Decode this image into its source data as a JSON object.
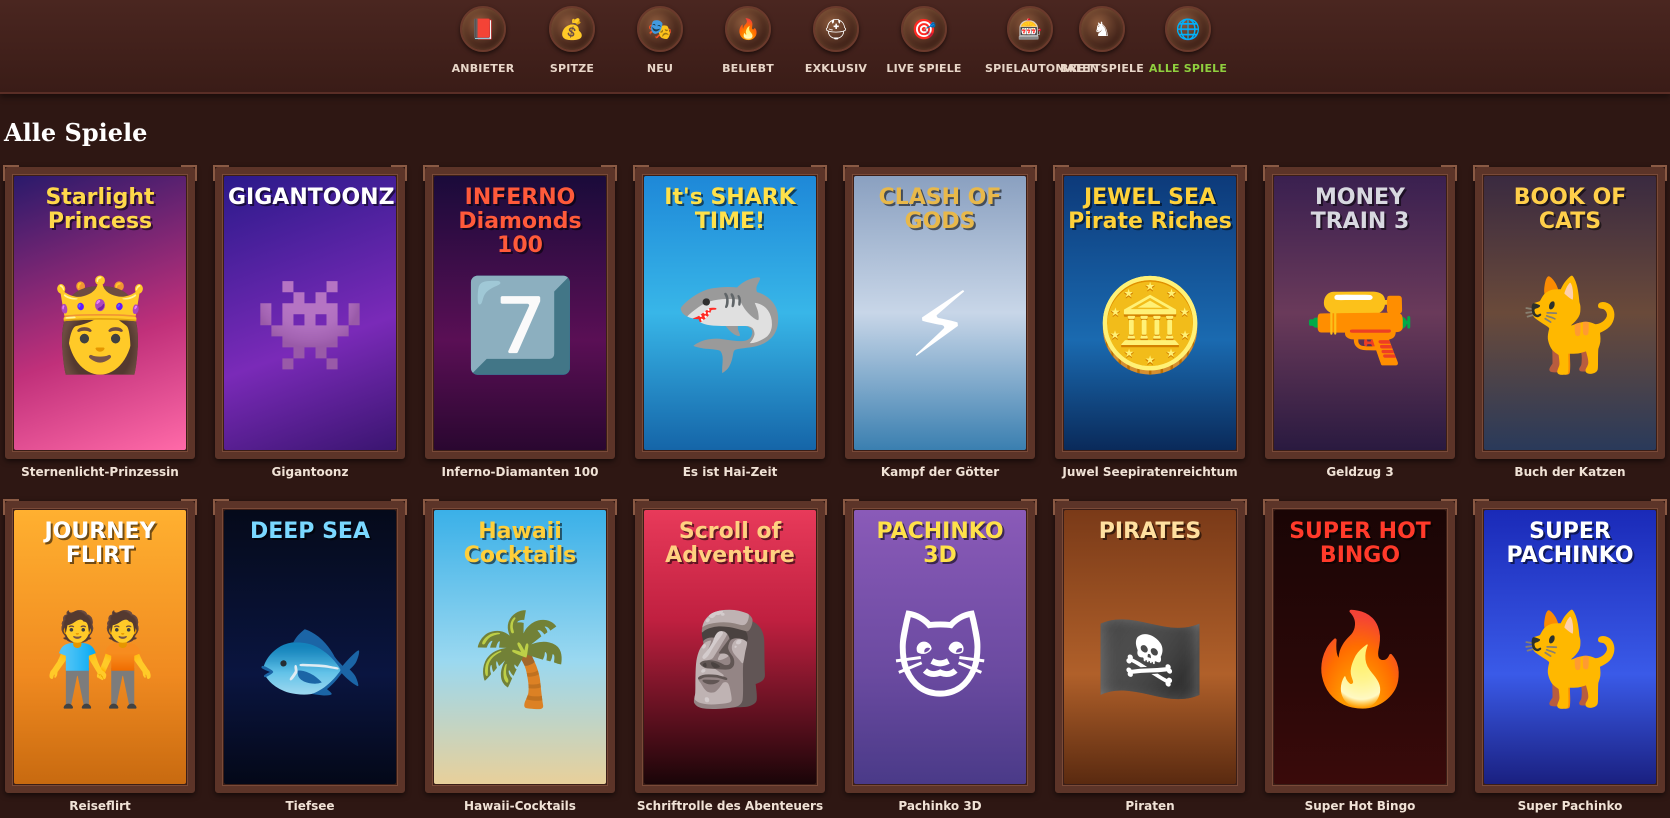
{
  "nav": {
    "items": [
      {
        "label": "ANBIETER",
        "icon": "book-icon",
        "glyph": "📕"
      },
      {
        "label": "SPITZE",
        "icon": "treasure-chest-icon",
        "glyph": "💰"
      },
      {
        "label": "NEU",
        "icon": "curtain-icon",
        "glyph": "🎭"
      },
      {
        "label": "BELIEBT",
        "icon": "torch-icon",
        "glyph": "🔥"
      },
      {
        "label": "EXKLUSIV",
        "icon": "viking-helmet-icon",
        "glyph": "⛑"
      },
      {
        "label": "LIVE SPIELE",
        "icon": "target-icon",
        "glyph": "🎯"
      },
      {
        "label": "SPIELAUTOMATEN",
        "icon": "slot-machine-icon",
        "glyph": "🎰"
      },
      {
        "label": "BRETTSPIELE",
        "icon": "chess-knight-icon",
        "glyph": "♞"
      },
      {
        "label": "ALLE SPIELE",
        "icon": "globe-icon",
        "glyph": "🌐"
      }
    ],
    "active_index": 8,
    "active_color": "#8fcf3e"
  },
  "page_title": "Alle Spiele",
  "games": [
    {
      "name": "Sternenlicht-Prinzessin",
      "art_title": "Starlight Princess",
      "bg": "linear-gradient(160deg,#2a1a6b,#c0307a 60%,#ff6aa8)",
      "title_color": "#ffd84a",
      "glyph": "👸"
    },
    {
      "name": "Gigantoonz",
      "art_title": "GIGANTOONZ",
      "bg": "linear-gradient(160deg,#2b1a8a,#7a2ab8 60%,#3a1570)",
      "title_color": "#ffffff",
      "glyph": "👾"
    },
    {
      "name": "Inferno-Diamanten 100",
      "art_title": "INFERNO Diamonds 100",
      "bg": "linear-gradient(180deg,#1a0b3a,#5a0f55 60%,#2a0730)",
      "title_color": "#ff5a3a",
      "glyph": "7️⃣"
    },
    {
      "name": "Es ist Hai-Zeit",
      "art_title": "It's SHARK TIME!",
      "bg": "linear-gradient(180deg,#1e88d8,#38b6e8 50%,#1565a8)",
      "title_color": "#ffe14a",
      "glyph": "🦈"
    },
    {
      "name": "Kampf der Götter",
      "art_title": "CLASH OF GODS",
      "bg": "linear-gradient(180deg,#8aa0c0,#c8d6e8 50%,#3a7fb0)",
      "title_color": "#e8b84a",
      "glyph": "⚡"
    },
    {
      "name": "Juwel Seepiratenreichtum",
      "art_title": "JEWEL SEA Pirate Riches",
      "bg": "linear-gradient(180deg,#0d3a7a,#1a6ab0 60%,#0a2a5a)",
      "title_color": "#ffd23a",
      "glyph": "🪙"
    },
    {
      "name": "Geldzug 3",
      "art_title": "MONEY TRAIN 3",
      "bg": "linear-gradient(180deg,#3a2050,#6a3a5a 50%,#2a1a40)",
      "title_color": "#d8d8e0",
      "glyph": "🔫"
    },
    {
      "name": "Buch der Katzen",
      "art_title": "BOOK OF CATS",
      "bg": "linear-gradient(180deg,#3a2a40,#6a4a3a 50%,#2a3a5a)",
      "title_color": "#ffcf4a",
      "glyph": "🐈"
    },
    {
      "name": "Reiseflirt",
      "art_title": "JOURNEY FLIRT",
      "bg": "linear-gradient(180deg,#ffb030,#f08a20 60%,#c86a10)",
      "title_color": "#ffffff",
      "glyph": "🧑‍🤝‍🧑"
    },
    {
      "name": "Tiefsee",
      "art_title": "DEEP SEA",
      "bg": "linear-gradient(180deg,#050a1a,#0a1540 60%,#040818)",
      "title_color": "#7ad8ff",
      "glyph": "🐟"
    },
    {
      "name": "Hawaii-Cocktails",
      "art_title": "Hawaii Cocktails",
      "bg": "linear-gradient(180deg,#3ab0e8,#9ad8f0 55%,#e8d09a)",
      "title_color": "#ffcf3a",
      "glyph": "🌴"
    },
    {
      "name": "Schriftrolle des Abenteuers",
      "art_title": "Scroll of Adventure",
      "bg": "linear-gradient(180deg,#e83a5a,#c02040 40%,#1a0508)",
      "title_color": "#ffd080",
      "glyph": "🗿"
    },
    {
      "name": "Pachinko 3D",
      "art_title": "PACHINKO 3D",
      "bg": "linear-gradient(180deg,#8a5ab8,#6a4aa0 60%,#4a3a88)",
      "title_color": "#ffe14a",
      "glyph": "🐱"
    },
    {
      "name": "Piraten",
      "art_title": "PIRATES",
      "bg": "linear-gradient(180deg,#7a3a18,#b0602a 60%,#5a2a10)",
      "title_color": "#ffe0a0",
      "glyph": "🏴‍☠️"
    },
    {
      "name": "Super Hot Bingo",
      "art_title": "SUPER HOT BINGO",
      "bg": "linear-gradient(180deg,#1a0505,#2a0808 60%,#3a0a0a)",
      "title_color": "#ff3a2a",
      "glyph": "🔥"
    },
    {
      "name": "Super Pachinko",
      "art_title": "SUPER PACHINKO",
      "bg": "linear-gradient(180deg,#1a2ab8,#3a5ae8 60%,#1a2080)",
      "title_color": "#ffffff",
      "glyph": "🐈"
    }
  ]
}
